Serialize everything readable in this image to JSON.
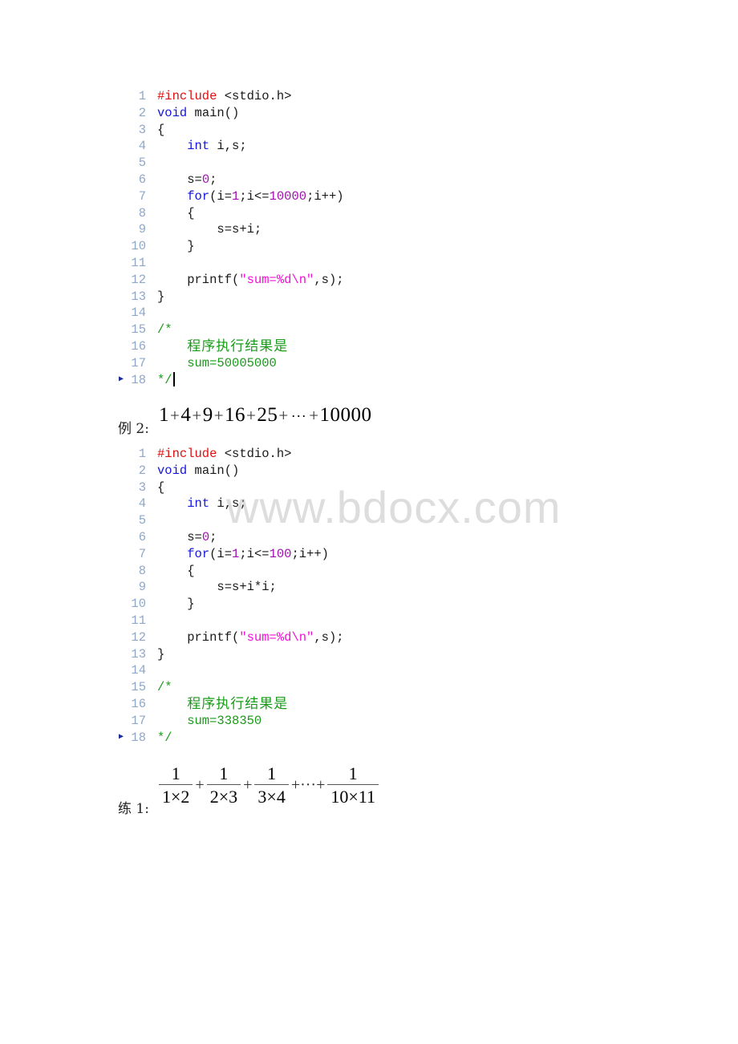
{
  "watermark": "www.bdocx.com",
  "example1": {
    "lines": [
      {
        "n": "1",
        "parts": [
          {
            "t": "#include",
            "c": "pp"
          },
          {
            "t": " <stdio.h>",
            "c": ""
          }
        ]
      },
      {
        "n": "2",
        "parts": [
          {
            "t": "void",
            "c": "kw"
          },
          {
            "t": " main()",
            "c": ""
          }
        ]
      },
      {
        "n": "3",
        "parts": [
          {
            "t": "{",
            "c": ""
          }
        ]
      },
      {
        "n": "4",
        "parts": [
          {
            "t": "    ",
            "c": ""
          },
          {
            "t": "int",
            "c": "kw"
          },
          {
            "t": " i,s;",
            "c": ""
          }
        ]
      },
      {
        "n": "5",
        "parts": []
      },
      {
        "n": "6",
        "parts": [
          {
            "t": "    s=",
            "c": ""
          },
          {
            "t": "0",
            "c": "num"
          },
          {
            "t": ";",
            "c": ""
          }
        ]
      },
      {
        "n": "7",
        "parts": [
          {
            "t": "    ",
            "c": ""
          },
          {
            "t": "for",
            "c": "kw"
          },
          {
            "t": "(i=",
            "c": ""
          },
          {
            "t": "1",
            "c": "num"
          },
          {
            "t": ";i<=",
            "c": ""
          },
          {
            "t": "10000",
            "c": "num"
          },
          {
            "t": ";i++)",
            "c": ""
          }
        ]
      },
      {
        "n": "8",
        "parts": [
          {
            "t": "    {",
            "c": ""
          }
        ]
      },
      {
        "n": "9",
        "parts": [
          {
            "t": "        s=s+i;",
            "c": ""
          }
        ]
      },
      {
        "n": "10",
        "parts": [
          {
            "t": "    }",
            "c": ""
          }
        ]
      },
      {
        "n": "11",
        "parts": []
      },
      {
        "n": "12",
        "parts": [
          {
            "t": "    printf(",
            "c": ""
          },
          {
            "t": "\"sum=%d\\n\"",
            "c": "str"
          },
          {
            "t": ",s);",
            "c": ""
          }
        ]
      },
      {
        "n": "13",
        "parts": [
          {
            "t": "}",
            "c": ""
          }
        ]
      },
      {
        "n": "14",
        "parts": []
      },
      {
        "n": "15",
        "parts": [
          {
            "t": "/*",
            "c": "cm"
          }
        ]
      },
      {
        "n": "16",
        "parts": [
          {
            "t": "    ",
            "c": "cm"
          },
          {
            "t": "程序执行结果是",
            "c": "cm cn"
          }
        ]
      },
      {
        "n": "17",
        "parts": [
          {
            "t": "    sum=50005000",
            "c": "cm"
          }
        ]
      },
      {
        "n": "18",
        "parts": [
          {
            "t": "*/",
            "c": "cm"
          }
        ],
        "marker": true,
        "caret": true
      }
    ]
  },
  "example2": {
    "label": "例 2:",
    "formula_terms": [
      "1",
      "+",
      "4",
      "+",
      "9",
      "+",
      "16",
      "+",
      "25",
      "+",
      "···",
      "+",
      "10000"
    ],
    "lines": [
      {
        "n": "1",
        "parts": [
          {
            "t": "#include",
            "c": "pp"
          },
          {
            "t": " <stdio.h>",
            "c": ""
          }
        ]
      },
      {
        "n": "2",
        "parts": [
          {
            "t": "void",
            "c": "kw"
          },
          {
            "t": " main()",
            "c": ""
          }
        ]
      },
      {
        "n": "3",
        "parts": [
          {
            "t": "{",
            "c": ""
          }
        ]
      },
      {
        "n": "4",
        "parts": [
          {
            "t": "    ",
            "c": ""
          },
          {
            "t": "int",
            "c": "kw"
          },
          {
            "t": " i,s;",
            "c": ""
          }
        ]
      },
      {
        "n": "5",
        "parts": []
      },
      {
        "n": "6",
        "parts": [
          {
            "t": "    s=",
            "c": ""
          },
          {
            "t": "0",
            "c": "num"
          },
          {
            "t": ";",
            "c": ""
          }
        ]
      },
      {
        "n": "7",
        "parts": [
          {
            "t": "    ",
            "c": ""
          },
          {
            "t": "for",
            "c": "kw"
          },
          {
            "t": "(i=",
            "c": ""
          },
          {
            "t": "1",
            "c": "num"
          },
          {
            "t": ";i<=",
            "c": ""
          },
          {
            "t": "100",
            "c": "num"
          },
          {
            "t": ";i++)",
            "c": ""
          }
        ]
      },
      {
        "n": "8",
        "parts": [
          {
            "t": "    {",
            "c": ""
          }
        ]
      },
      {
        "n": "9",
        "parts": [
          {
            "t": "        s=s+i*i;",
            "c": ""
          }
        ]
      },
      {
        "n": "10",
        "parts": [
          {
            "t": "    }",
            "c": ""
          }
        ]
      },
      {
        "n": "11",
        "parts": []
      },
      {
        "n": "12",
        "parts": [
          {
            "t": "    printf(",
            "c": ""
          },
          {
            "t": "\"sum=%d\\n\"",
            "c": "str"
          },
          {
            "t": ",s);",
            "c": ""
          }
        ]
      },
      {
        "n": "13",
        "parts": [
          {
            "t": "}",
            "c": ""
          }
        ]
      },
      {
        "n": "14",
        "parts": []
      },
      {
        "n": "15",
        "parts": [
          {
            "t": "/*",
            "c": "cm"
          }
        ]
      },
      {
        "n": "16",
        "parts": [
          {
            "t": "    ",
            "c": "cm"
          },
          {
            "t": "程序执行结果是",
            "c": "cm cn"
          }
        ]
      },
      {
        "n": "17",
        "parts": [
          {
            "t": "    sum=338350",
            "c": "cm"
          }
        ]
      },
      {
        "n": "18",
        "parts": [
          {
            "t": "*/",
            "c": "cm"
          }
        ],
        "marker": true
      }
    ]
  },
  "exercise1": {
    "label": "练 1:",
    "fractions": [
      {
        "num": "1",
        "den": "1×2"
      },
      {
        "num": "1",
        "den": "2×3"
      },
      {
        "num": "1",
        "den": "3×4"
      },
      {
        "num": "1",
        "den": "10×11"
      }
    ],
    "operators": [
      "+",
      "+",
      "+···+"
    ]
  }
}
